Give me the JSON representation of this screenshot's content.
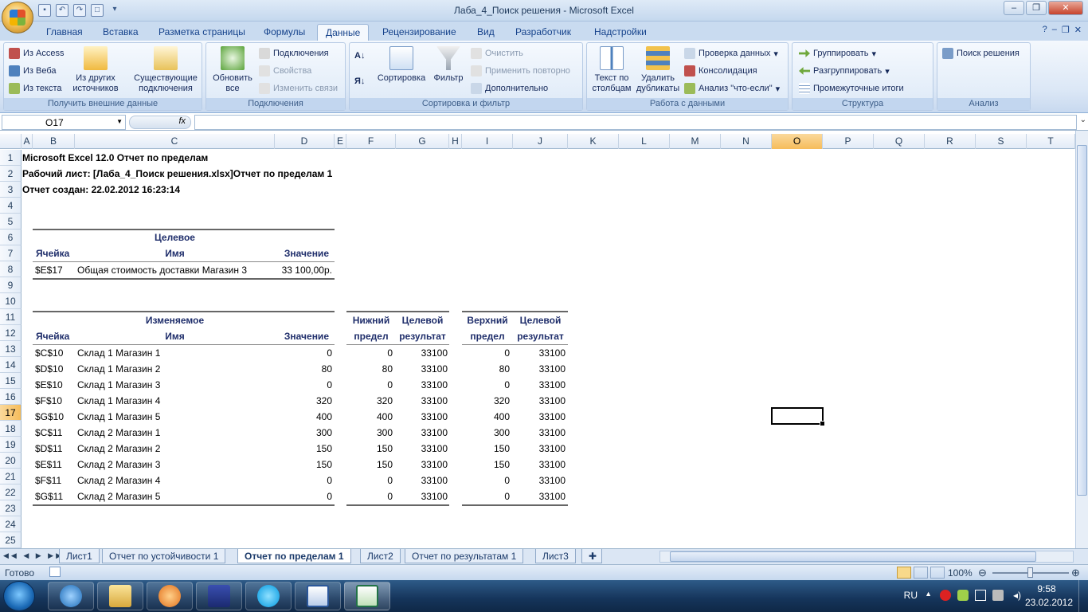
{
  "window": {
    "title": "Лаба_4_Поиск решения - Microsoft Excel"
  },
  "tabs": [
    {
      "label": "Главная"
    },
    {
      "label": "Вставка"
    },
    {
      "label": "Разметка страницы"
    },
    {
      "label": "Формулы"
    },
    {
      "label": "Данные"
    },
    {
      "label": "Рецензирование"
    },
    {
      "label": "Вид"
    },
    {
      "label": "Разработчик"
    },
    {
      "label": "Надстройки"
    }
  ],
  "ribbon": {
    "get_external": {
      "label": "Получить внешние данные",
      "from_access": "Из Access",
      "from_web": "Из Веба",
      "from_text": "Из текста",
      "from_other": "Из других источников",
      "existing": "Существующие подключения"
    },
    "connections": {
      "label": "Подключения",
      "refresh": "Обновить все",
      "connections": "Подключения",
      "properties": "Свойства",
      "edit_links": "Изменить связи"
    },
    "sort_filter": {
      "label": "Сортировка и фильтр",
      "sort": "Сортировка",
      "filter": "Фильтр",
      "clear": "Очистить",
      "reapply": "Применить повторно",
      "advanced": "Дополнительно"
    },
    "data_tools": {
      "label": "Работа с данными",
      "text_to_columns": "Текст по столбцам",
      "remove_duplicates": "Удалить дубликаты",
      "validation": "Проверка данных",
      "consolidate": "Консолидация",
      "what_if": "Анализ \"что-если\""
    },
    "outline": {
      "label": "Структура",
      "group": "Группировать",
      "ungroup": "Разгруппировать",
      "subtotal": "Промежуточные итоги"
    },
    "analysis": {
      "label": "Анализ",
      "solver": "Поиск решения"
    }
  },
  "formula_bar": {
    "name_box": "O17",
    "fx": "fx",
    "formula": ""
  },
  "columns": [
    "A",
    "B",
    "C",
    "D",
    "E",
    "F",
    "G",
    "H",
    "I",
    "J",
    "K",
    "L",
    "M",
    "N",
    "O",
    "P",
    "Q",
    "R",
    "S",
    "T"
  ],
  "rows": [
    "1",
    "2",
    "3",
    "4",
    "5",
    "6",
    "7",
    "8",
    "9",
    "10",
    "11",
    "12",
    "13",
    "14",
    "15",
    "16",
    "17",
    "18",
    "19",
    "20",
    "21",
    "22",
    "23",
    "24",
    "25"
  ],
  "report": {
    "line1": "Microsoft Excel 12.0 Отчет по пределам",
    "line2": "Рабочий лист: [Лаба_4_Поиск решения.xlsx]Отчет по пределам 1",
    "line3": "Отчет создан: 22.02.2012 16:23:14",
    "target_header": "Целевое",
    "cell_header": "Ячейка",
    "name_header": "Имя",
    "value_header": "Значение",
    "target_row": {
      "cell": "$E$17",
      "name": "Общая стоимость доставки Магазин 3",
      "value": "33 100,00р."
    },
    "changing_header": "Изменяемое",
    "lower_h1": "Нижний",
    "lower_h2": "предел",
    "target_res_h1": "Целевой",
    "target_res_h2": "результат",
    "upper_h1": "Верхний",
    "upper_h2": "предел",
    "rows": [
      {
        "cell": "$C$10",
        "name": "Склад 1 Магазин 1",
        "value": "0",
        "lower": "0",
        "lower_res": "33100",
        "upper": "0",
        "upper_res": "33100"
      },
      {
        "cell": "$D$10",
        "name": "Склад 1 Магазин 2",
        "value": "80",
        "lower": "80",
        "lower_res": "33100",
        "upper": "80",
        "upper_res": "33100"
      },
      {
        "cell": "$E$10",
        "name": "Склад 1 Магазин 3",
        "value": "0",
        "lower": "0",
        "lower_res": "33100",
        "upper": "0",
        "upper_res": "33100"
      },
      {
        "cell": "$F$10",
        "name": "Склад 1 Магазин 4",
        "value": "320",
        "lower": "320",
        "lower_res": "33100",
        "upper": "320",
        "upper_res": "33100"
      },
      {
        "cell": "$G$10",
        "name": "Склад 1 Магазин 5",
        "value": "400",
        "lower": "400",
        "lower_res": "33100",
        "upper": "400",
        "upper_res": "33100"
      },
      {
        "cell": "$C$11",
        "name": "Склад 2 Магазин 1",
        "value": "300",
        "lower": "300",
        "lower_res": "33100",
        "upper": "300",
        "upper_res": "33100"
      },
      {
        "cell": "$D$11",
        "name": "Склад 2 Магазин 2",
        "value": "150",
        "lower": "150",
        "lower_res": "33100",
        "upper": "150",
        "upper_res": "33100"
      },
      {
        "cell": "$E$11",
        "name": "Склад 2 Магазин 3",
        "value": "150",
        "lower": "150",
        "lower_res": "33100",
        "upper": "150",
        "upper_res": "33100"
      },
      {
        "cell": "$F$11",
        "name": "Склад 2 Магазин 4",
        "value": "0",
        "lower": "0",
        "lower_res": "33100",
        "upper": "0",
        "upper_res": "33100"
      },
      {
        "cell": "$G$11",
        "name": "Склад 2 Магазин 5",
        "value": "0",
        "lower": "0",
        "lower_res": "33100",
        "upper": "0",
        "upper_res": "33100"
      }
    ]
  },
  "sheets": [
    {
      "label": "Лист1"
    },
    {
      "label": "Отчет по устойчивости 1"
    },
    {
      "label": "Отчет по пределам 1"
    },
    {
      "label": "Лист2"
    },
    {
      "label": "Отчет по результатам 1"
    },
    {
      "label": "Лист3"
    }
  ],
  "status": {
    "ready": "Готово",
    "zoom": "100%"
  },
  "tray": {
    "lang": "RU",
    "time": "9:58",
    "date": "23.02.2012"
  },
  "colors": {
    "accent": "#15428b",
    "header_text": "#1f2e6b",
    "selection": "#f6bc5a"
  }
}
